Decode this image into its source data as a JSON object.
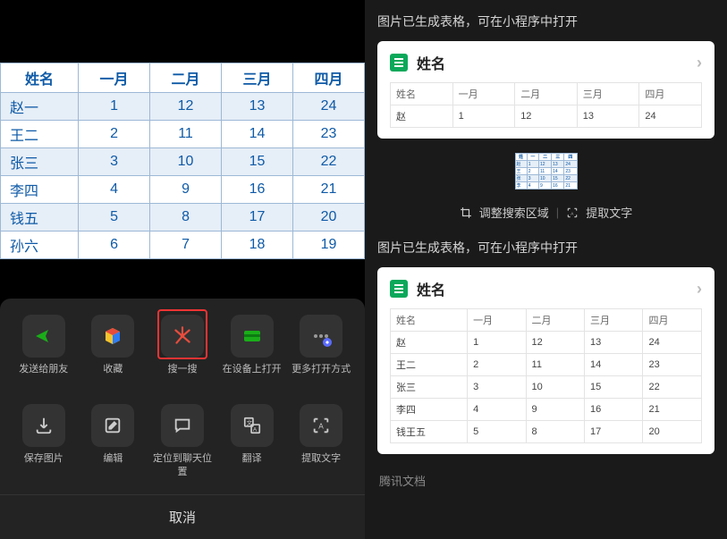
{
  "source_table": {
    "headers": [
      "姓名",
      "一月",
      "二月",
      "三月",
      "四月"
    ],
    "rows": [
      [
        "赵一",
        "1",
        "12",
        "13",
        "24"
      ],
      [
        "王二",
        "2",
        "11",
        "14",
        "23"
      ],
      [
        "张三",
        "3",
        "10",
        "15",
        "22"
      ],
      [
        "李四",
        "4",
        "9",
        "16",
        "21"
      ],
      [
        "钱五",
        "5",
        "8",
        "17",
        "20"
      ],
      [
        "孙六",
        "6",
        "7",
        "18",
        "19"
      ]
    ]
  },
  "sheet": {
    "row1": {
      "labels": [
        "发送给朋友",
        "收藏",
        "搜一搜",
        "在设备上打开",
        "更多打开方式"
      ]
    },
    "row2": {
      "labels": [
        "保存图片",
        "编辑",
        "定位到聊天位置",
        "翻译",
        "提取文字"
      ]
    },
    "cancel": "取消"
  },
  "right": {
    "notice": "图片已生成表格，可在小程序中打开",
    "card_title": "姓名",
    "preview1": {
      "headers": [
        "姓名",
        "一月",
        "二月",
        "三月",
        "四月"
      ],
      "rows": [
        [
          "赵",
          "1",
          "12",
          "13",
          "24"
        ]
      ]
    },
    "preview2": {
      "headers": [
        "姓名",
        "一月",
        "二月",
        "三月",
        "四月"
      ],
      "rows": [
        [
          "赵",
          "1",
          "12",
          "13",
          "24"
        ],
        [
          "王二",
          "2",
          "11",
          "14",
          "23"
        ],
        [
          "张三",
          "3",
          "10",
          "15",
          "22"
        ],
        [
          "李四",
          "4",
          "9",
          "16",
          "21"
        ],
        [
          "钱王五",
          "5",
          "8",
          "17",
          "20"
        ]
      ]
    },
    "tools": {
      "crop": "调整搜索区域",
      "extract": "提取文字"
    },
    "brand": "腾讯文档"
  },
  "chart_data": {
    "type": "table",
    "title": "姓名",
    "columns": [
      "姓名",
      "一月",
      "二月",
      "三月",
      "四月"
    ],
    "data": [
      {
        "姓名": "赵一",
        "一月": 1,
        "二月": 12,
        "三月": 13,
        "四月": 24
      },
      {
        "姓名": "王二",
        "一月": 2,
        "二月": 11,
        "三月": 14,
        "四月": 23
      },
      {
        "姓名": "张三",
        "一月": 3,
        "二月": 10,
        "三月": 15,
        "四月": 22
      },
      {
        "姓名": "李四",
        "一月": 4,
        "二月": 9,
        "三月": 16,
        "四月": 21
      },
      {
        "姓名": "钱五",
        "一月": 5,
        "二月": 8,
        "三月": 17,
        "四月": 20
      },
      {
        "姓名": "孙六",
        "一月": 6,
        "二月": 7,
        "三月": 18,
        "四月": 19
      }
    ]
  }
}
